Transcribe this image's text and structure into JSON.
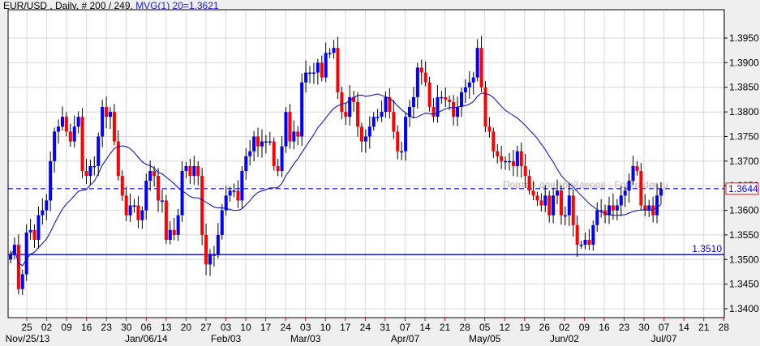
{
  "header": {
    "symbol_info": "EUR/USD , Daily, # 200 / 249,",
    "indicator": "MVG(1) 20=1.3621"
  },
  "watermark": "Портал для трейдеров - ForTrader.ru",
  "colors": {
    "bull": "#0000ff",
    "bear": "#ff0000",
    "ma": "#0000c0",
    "grid": "#d8d8d8",
    "price_box": "#ff0000"
  },
  "chart_data": {
    "type": "candlestick",
    "title": "EUR/USD , Daily",
    "ylim": [
      1.338,
      1.4005
    ],
    "y_ticks": [
      "1.3400",
      "1.3450",
      "1.3500",
      "1.3550",
      "1.3600",
      "1.3650",
      "1.3700",
      "1.3750",
      "1.3800",
      "1.3850",
      "1.3900",
      "1.3950"
    ],
    "x_day_ticks": [
      "25",
      "02",
      "09",
      "16",
      "23",
      "30",
      "06",
      "13",
      "20",
      "27",
      "03",
      "10",
      "17",
      "24",
      "03",
      "10",
      "17",
      "24",
      "31",
      "07",
      "14",
      "21",
      "28",
      "05",
      "12",
      "19",
      "26",
      "02",
      "09",
      "16",
      "23",
      "30",
      "07",
      "14",
      "21",
      "28"
    ],
    "x_month_labels": [
      {
        "label": "Nov/25/13",
        "tick": 0
      },
      {
        "label": "Jan/06/14",
        "tick": 6
      },
      {
        "label": "Feb/03",
        "tick": 10
      },
      {
        "label": "Mar/03",
        "tick": 14
      },
      {
        "label": "Apr/07",
        "tick": 19
      },
      {
        "label": "May/05",
        "tick": 23
      },
      {
        "label": "Jun/02",
        "tick": 27
      },
      {
        "label": "Jul/07",
        "tick": 32
      }
    ],
    "first_open": 1.35,
    "closes": [
      1.351,
      1.353,
      1.344,
      1.347,
      1.3555,
      1.356,
      1.354,
      1.359,
      1.36,
      1.362,
      1.37,
      1.376,
      1.377,
      1.379,
      1.376,
      1.374,
      1.377,
      1.379,
      1.368,
      1.367,
      1.369,
      1.369,
      1.375,
      1.381,
      1.379,
      1.38,
      1.374,
      1.367,
      1.363,
      1.359,
      1.361,
      1.361,
      1.358,
      1.36,
      1.366,
      1.368,
      1.367,
      1.362,
      1.362,
      1.354,
      1.356,
      1.355,
      1.359,
      1.368,
      1.369,
      1.367,
      1.369,
      1.367,
      1.355,
      1.349,
      1.351,
      1.351,
      1.355,
      1.36,
      1.363,
      1.364,
      1.364,
      1.362,
      1.368,
      1.371,
      1.372,
      1.375,
      1.373,
      1.374,
      1.374,
      1.374,
      1.369,
      1.368,
      1.373,
      1.38,
      1.374,
      1.376,
      1.375,
      1.386,
      1.388,
      1.388,
      1.388,
      1.39,
      1.387,
      1.392,
      1.392,
      1.393,
      1.384,
      1.38,
      1.379,
      1.383,
      1.382,
      1.377,
      1.374,
      1.375,
      1.377,
      1.379,
      1.379,
      1.38,
      1.383,
      1.38,
      1.376,
      1.372,
      1.372,
      1.379,
      1.381,
      1.383,
      1.389,
      1.388,
      1.386,
      1.381,
      1.379,
      1.383,
      1.383,
      1.3825,
      1.382,
      1.379,
      1.381,
      1.384,
      1.385,
      1.386,
      1.387,
      1.393,
      1.385,
      1.377,
      1.376,
      1.372,
      1.371,
      1.37,
      1.37,
      1.37,
      1.369,
      1.372,
      1.369,
      1.367,
      1.364,
      1.363,
      1.362,
      1.361,
      1.363,
      1.359,
      1.363,
      1.364,
      1.359,
      1.359,
      1.363,
      1.357,
      1.353,
      1.353,
      1.354,
      1.353,
      1.357,
      1.36,
      1.36,
      1.359,
      1.361,
      1.36,
      1.361,
      1.363,
      1.364,
      1.366,
      1.369,
      1.368,
      1.361,
      1.36,
      1.361,
      1.359,
      1.363,
      1.3644
    ],
    "ma_period": 20,
    "ma_last": 1.3621,
    "current_price": "1.3644",
    "support_level": "1.3510"
  }
}
